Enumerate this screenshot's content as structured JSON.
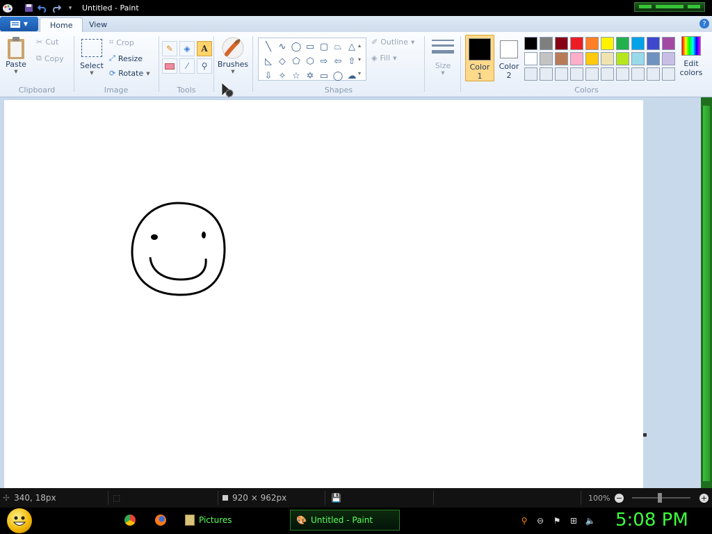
{
  "window": {
    "title": "Untitled - Paint"
  },
  "tabs": [
    {
      "label": "Home"
    },
    {
      "label": "View"
    }
  ],
  "help_label": "?",
  "clipboard": {
    "group_label": "Clipboard",
    "paste": "Paste",
    "cut": "Cut",
    "copy": "Copy"
  },
  "image": {
    "group_label": "Image",
    "select": "Select",
    "crop": "Crop",
    "resize": "Resize",
    "rotate": "Rotate"
  },
  "tools": {
    "group_label": "Tools",
    "text_tool": "A"
  },
  "brushes": {
    "label": "Brushes"
  },
  "shapes": {
    "group_label": "Shapes",
    "outline": "Outline",
    "fill": "Fill"
  },
  "size": {
    "label": "Size"
  },
  "colors": {
    "group_label": "Colors",
    "color1_line1": "Color",
    "color1_line2": "1",
    "color2_line1": "Color",
    "color2_line2": "2",
    "edit_line1": "Edit",
    "edit_line2": "colors",
    "color1": "#000000",
    "color2": "#ffffff",
    "palette_row1": [
      "#000000",
      "#7f7f7f",
      "#880015",
      "#ed1c24",
      "#ff7f27",
      "#fff200",
      "#22b14c",
      "#00a2e8",
      "#3f48cc",
      "#a349a4"
    ],
    "palette_row2": [
      "#ffffff",
      "#c3c3c3",
      "#b97a57",
      "#ffaec9",
      "#ffc90e",
      "#efe4b0",
      "#b5e61d",
      "#99d9ea",
      "#7092be",
      "#c8bfe7"
    ],
    "palette_row3": [
      "#e6ecf4",
      "#e6ecf4",
      "#e6ecf4",
      "#e6ecf4",
      "#e6ecf4",
      "#e6ecf4",
      "#e6ecf4",
      "#e6ecf4",
      "#e6ecf4",
      "#e6ecf4"
    ]
  },
  "status": {
    "cursor_pos": "340, 18px",
    "canvas_size": "920 × 962px",
    "zoom": "100%",
    "zoom_out": "−",
    "zoom_in": "+"
  },
  "taskbar": {
    "tasks": [
      {
        "label": "Pictures"
      },
      {
        "label": "Untitled - Paint"
      }
    ],
    "clock": "5:08 PM"
  }
}
